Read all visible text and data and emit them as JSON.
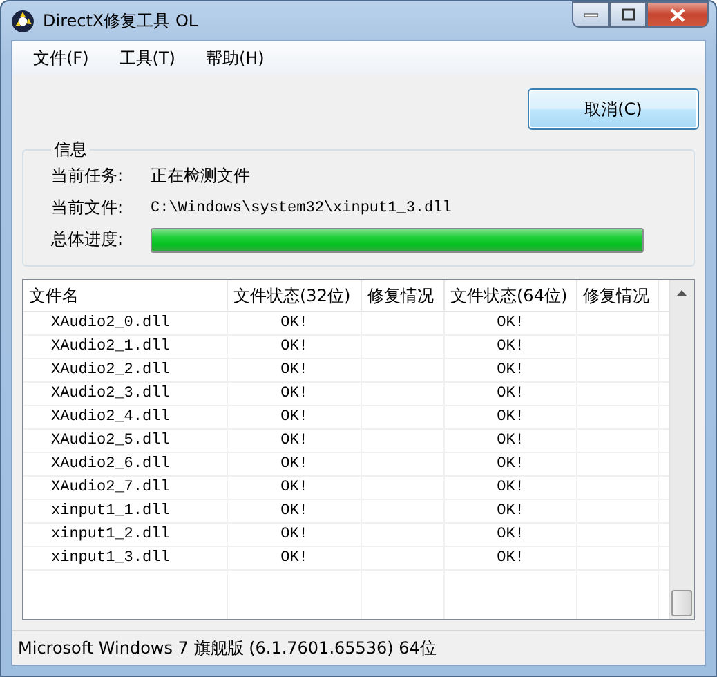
{
  "window": {
    "title": "DirectX修复工具 OL"
  },
  "menu": [
    "文件(F)",
    "工具(T)",
    "帮助(H)"
  ],
  "cancel_button": "取消(C)",
  "info": {
    "title": "信息",
    "task_label": "当前任务:",
    "task_value": "正在检测文件",
    "file_label": "当前文件:",
    "file_value": "C:\\Windows\\system32\\xinput1_3.dll",
    "progress_label": "总体进度:",
    "level": 1
  },
  "table": {
    "columns": [
      "文件名",
      "文件状态(32位)",
      "修复情况",
      "文件状态(64位)",
      "修复情况"
    ],
    "rows": [
      {
        "name": "XAudio2_0.dll",
        "status32": "OK!",
        "status64": "OK!"
      },
      {
        "name": "XAudio2_1.dll",
        "status32": "OK!",
        "status64": "OK!"
      },
      {
        "name": "XAudio2_2.dll",
        "status32": "OK!",
        "status64": "OK!"
      },
      {
        "name": "XAudio2_3.dll",
        "status32": "OK!",
        "status64": "OK!"
      },
      {
        "name": "XAudio2_4.dll",
        "status32": "OK!",
        "status64": "OK!"
      },
      {
        "name": "XAudio2_5.dll",
        "status32": "OK!",
        "status64": "OK!"
      },
      {
        "name": "XAudio2_6.dll",
        "status32": "OK!",
        "status64": "OK!"
      },
      {
        "name": "XAudio2_7.dll",
        "status32": "OK!",
        "status64": "OK!"
      },
      {
        "name": "xinput1_1.dll",
        "status32": "OK!",
        "status64": "OK!"
      },
      {
        "name": "xinput1_2.dll",
        "status32": "OK!",
        "status64": "OK!"
      },
      {
        "name": "xinput1_3.dll",
        "status32": "OK!",
        "status64": "OK!"
      }
    ]
  },
  "status_bar": "Microsoft Windows 7 旗舰版 (6.1.7601.65536) 64位"
}
